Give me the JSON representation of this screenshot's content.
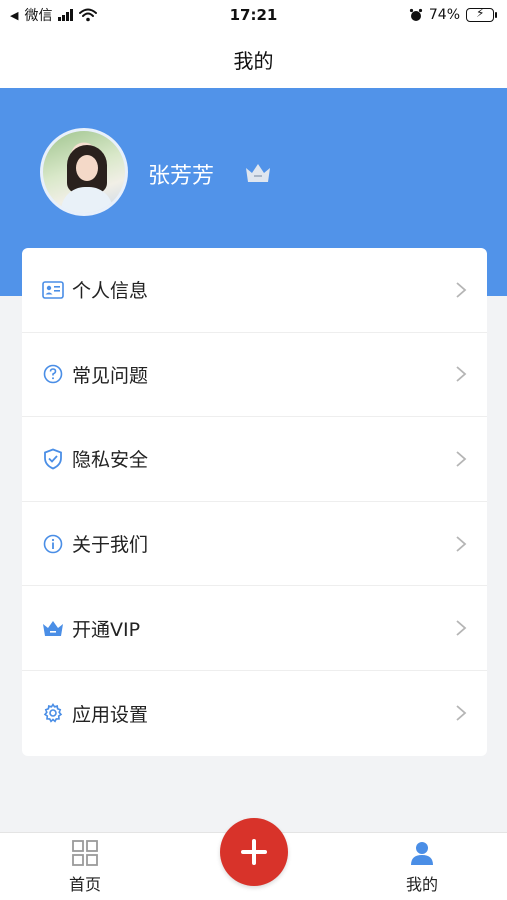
{
  "status_bar": {
    "back_app": "微信",
    "time": "17:21",
    "battery": "74%"
  },
  "page_title": "我的",
  "profile": {
    "username": "张芳芳",
    "avatar_icon": "user-avatar",
    "badge_icon": "crown-icon"
  },
  "menu": {
    "items": [
      {
        "label": "个人信息",
        "icon": "id-card-icon"
      },
      {
        "label": "常见问题",
        "icon": "question-circle-icon"
      },
      {
        "label": "隐私安全",
        "icon": "shield-check-icon"
      },
      {
        "label": "关于我们",
        "icon": "info-circle-icon"
      },
      {
        "label": "开通VIP",
        "icon": "crown-icon"
      },
      {
        "label": "应用设置",
        "icon": "gear-icon"
      }
    ]
  },
  "bottom_nav": {
    "home_label": "首页",
    "me_label": "我的",
    "add_icon": "plus-icon"
  },
  "colors": {
    "accent_blue": "#5193e9",
    "fab_red": "#d8332a",
    "battery_green": "#4cd964"
  }
}
